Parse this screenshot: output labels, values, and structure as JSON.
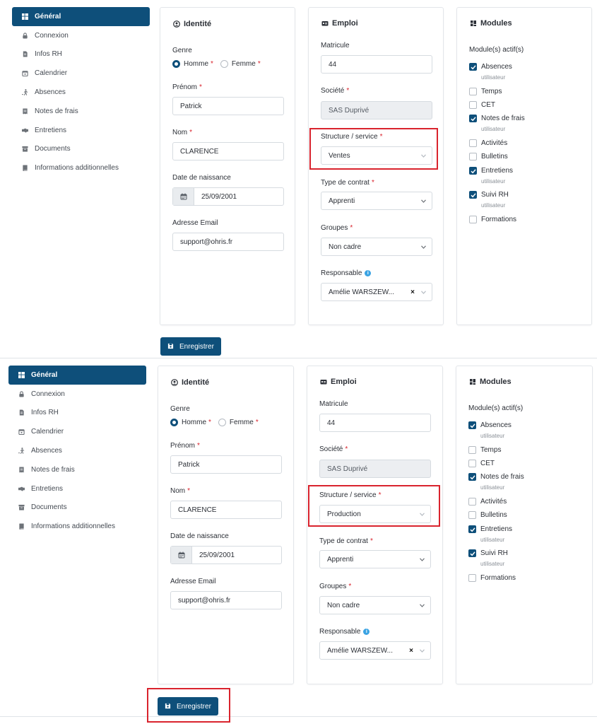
{
  "sidebar": {
    "items": [
      {
        "label": "Général",
        "icon": "layout-icon"
      },
      {
        "label": "Connexion",
        "icon": "lock-icon"
      },
      {
        "label": "Infos RH",
        "icon": "file-icon"
      },
      {
        "label": "Calendrier",
        "icon": "calendar-icon"
      },
      {
        "label": "Absences",
        "icon": "walking-icon"
      },
      {
        "label": "Notes de frais",
        "icon": "receipt-icon"
      },
      {
        "label": "Entretiens",
        "icon": "handshake-icon"
      },
      {
        "label": "Documents",
        "icon": "archive-icon"
      },
      {
        "label": "Informations additionnelles",
        "icon": "book-icon"
      }
    ]
  },
  "identity": {
    "title": "Identité",
    "genre_label": "Genre",
    "homme": "Homme",
    "femme": "Femme",
    "prenom_label": "Prénom",
    "prenom_value": "Patrick",
    "nom_label": "Nom",
    "nom_value": "CLARENCE",
    "dob_label": "Date de naissance",
    "dob_value": "25/09/2001",
    "email_label": "Adresse Email",
    "email_value": "support@ohris.fr"
  },
  "emploi": {
    "title": "Emploi",
    "matricule_label": "Matricule",
    "matricule_value": "44",
    "societe_label": "Société",
    "societe_value": "SAS Duprivé",
    "structure_label": "Structure / service",
    "contrat_label": "Type de contrat",
    "contrat_value": "Apprenti",
    "groupes_label": "Groupes",
    "groupes_value": "Non cadre",
    "responsable_label": "Responsable",
    "responsable_value": "Amélie WARSZEW...",
    "clear": "×"
  },
  "frames": [
    {
      "structure_value": "Ventes"
    },
    {
      "structure_value": "Production"
    }
  ],
  "modules": {
    "title": "Modules",
    "subtitle": "Module(s) actif(s)",
    "sub_label": "utilisateur",
    "items": [
      {
        "label": "Absences",
        "checked": true
      },
      {
        "label": "Temps",
        "checked": false
      },
      {
        "label": "CET",
        "checked": false
      },
      {
        "label": "Notes de frais",
        "checked": true
      },
      {
        "label": "Activités",
        "checked": false
      },
      {
        "label": "Bulletins",
        "checked": false
      },
      {
        "label": "Entretiens",
        "checked": true
      },
      {
        "label": "Suivi RH",
        "checked": true
      },
      {
        "label": "Formations",
        "checked": false
      }
    ]
  },
  "save_label": "Enregistrer",
  "required_mark": "*",
  "colors": {
    "primary": "#0e4f7a",
    "required": "#d9232d",
    "highlight": "#d9232d",
    "info": "#3aa3e3"
  }
}
